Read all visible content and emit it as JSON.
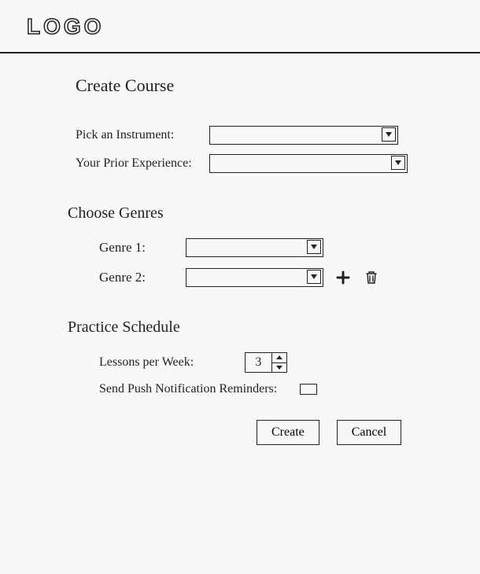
{
  "header": {
    "logo_text": "LOGO"
  },
  "page": {
    "title": "Create Course"
  },
  "course": {
    "instrument_label": "Pick an Instrument:",
    "instrument_value": "",
    "experience_label": "Your Prior Experience:",
    "experience_value": ""
  },
  "genres": {
    "section_title": "Choose Genres",
    "items": [
      {
        "label": "Genre 1:",
        "value": ""
      },
      {
        "label": "Genre 2:",
        "value": ""
      }
    ]
  },
  "schedule": {
    "section_title": "Practice Schedule",
    "lessons_label": "Lessons per Week:",
    "lessons_value": "3",
    "reminders_label": "Send Push Notification Reminders:"
  },
  "buttons": {
    "create": "Create",
    "cancel": "Cancel"
  }
}
